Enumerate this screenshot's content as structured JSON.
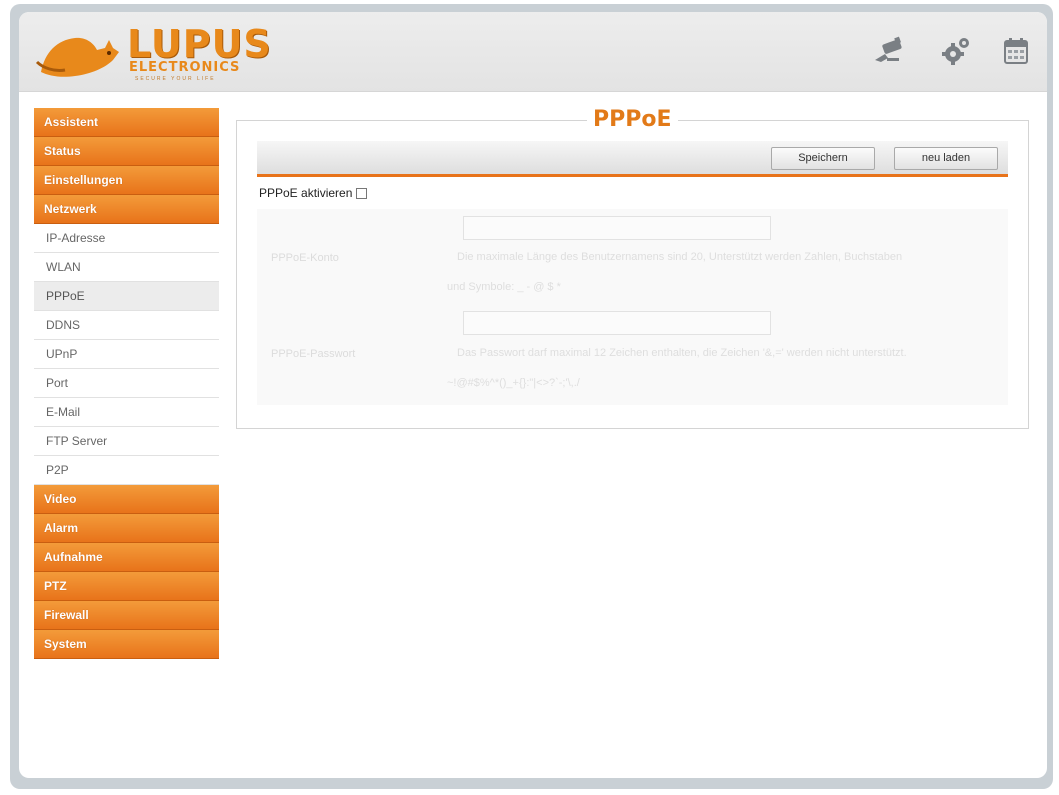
{
  "header": {
    "logo_text": "LUPUS",
    "logo_sub": "ELECTRONICS",
    "logo_tagline": "SECURE YOUR LIFE",
    "icons": [
      "camera-icon",
      "gear-icon",
      "calendar-icon"
    ]
  },
  "sidebar": {
    "items": [
      {
        "label": "Assistent",
        "type": "main"
      },
      {
        "label": "Status",
        "type": "main"
      },
      {
        "label": "Einstellungen",
        "type": "main"
      },
      {
        "label": "Netzwerk",
        "type": "main"
      },
      {
        "label": "IP-Adresse",
        "type": "sub"
      },
      {
        "label": "WLAN",
        "type": "sub"
      },
      {
        "label": "PPPoE",
        "type": "sub",
        "active": true
      },
      {
        "label": "DDNS",
        "type": "sub"
      },
      {
        "label": "UPnP",
        "type": "sub"
      },
      {
        "label": "Port",
        "type": "sub"
      },
      {
        "label": "E-Mail",
        "type": "sub"
      },
      {
        "label": "FTP Server",
        "type": "sub"
      },
      {
        "label": "P2P",
        "type": "sub"
      },
      {
        "label": "Video",
        "type": "main"
      },
      {
        "label": "Alarm",
        "type": "main"
      },
      {
        "label": "Aufnahme",
        "type": "main"
      },
      {
        "label": "PTZ",
        "type": "main"
      },
      {
        "label": "Firewall",
        "type": "main"
      },
      {
        "label": "System",
        "type": "main"
      }
    ]
  },
  "main": {
    "title": "PPPoE",
    "toolbar": {
      "save_label": "Speichern",
      "reload_label": "neu laden"
    },
    "enable_label": "PPPoE aktivieren",
    "enable_checked": false,
    "fields": [
      {
        "label": "PPPoE-Konto",
        "value": "",
        "hint_line1": "Die maximale Länge des Benutzernamens sind 20, Unterstützt werden Zahlen, Buchstaben",
        "hint_line2": "und Symbole: _ - @ $ *"
      },
      {
        "label": "PPPoE-Passwort",
        "value": "",
        "hint_line1": "Das Passwort darf maximal 12 Zeichen enthalten, die Zeichen '&,=' werden nicht unterstützt.",
        "hint_line2": "~!@#$%^*()_+{}:\"|<>?`-;'\\,./"
      }
    ]
  },
  "colors": {
    "accent": "#e8731a",
    "title": "#e27a18",
    "frame": "#c9d0d5"
  }
}
